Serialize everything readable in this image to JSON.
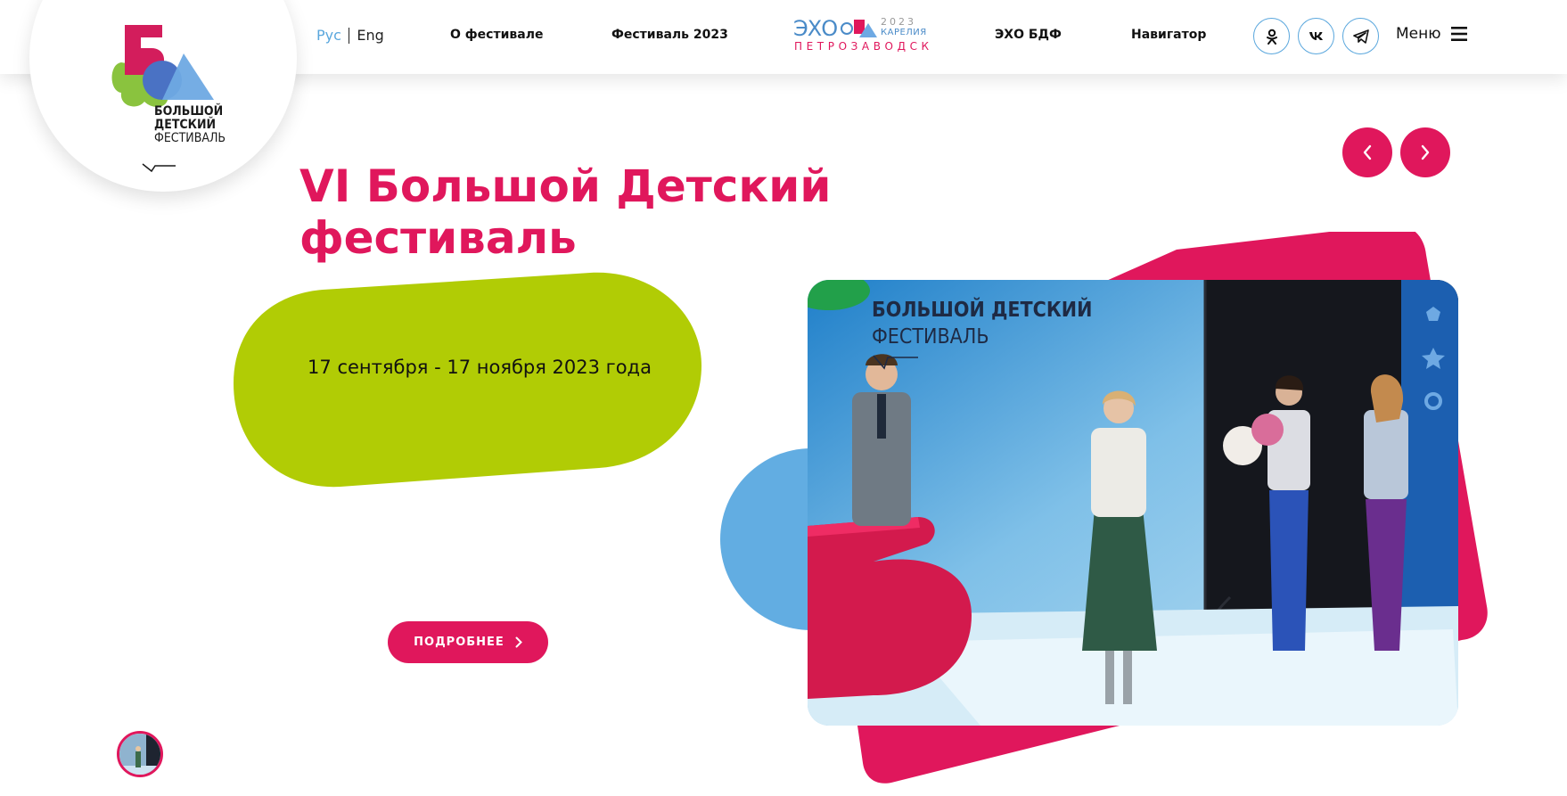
{
  "header": {
    "lang_ru": "Рус",
    "lang_en": "Eng",
    "nav": {
      "about": "О фестивале",
      "festival2023": "Фестиваль 2023",
      "echo": "ЭХО БДФ",
      "navigator": "Навигатор"
    },
    "echo_logo": {
      "word": "ЭХО",
      "year": "2023",
      "region": "КАРЕЛИЯ",
      "city": "ПЕТРОЗАВОДСК"
    },
    "menu_label": "Меню"
  },
  "logo": {
    "line1": "БОЛЬШОЙ",
    "line2": "ДЕТСКИЙ",
    "line3": "ФЕСТИВАЛЬ"
  },
  "hero": {
    "title_line1": "VI Большой Детский",
    "title_line2": "фестиваль",
    "dates": "17 сентября - 17 ноября 2023 года",
    "more_button": "ПОДРОБНЕЕ"
  },
  "photo": {
    "caption_line1": "БОЛЬШОЙ ДЕТСКИЙ",
    "caption_line2": "ФЕСТИВАЛЬ"
  },
  "colors": {
    "accent": "#e0175c",
    "lime": "#b1cc05",
    "blue": "#5aa7dd"
  }
}
